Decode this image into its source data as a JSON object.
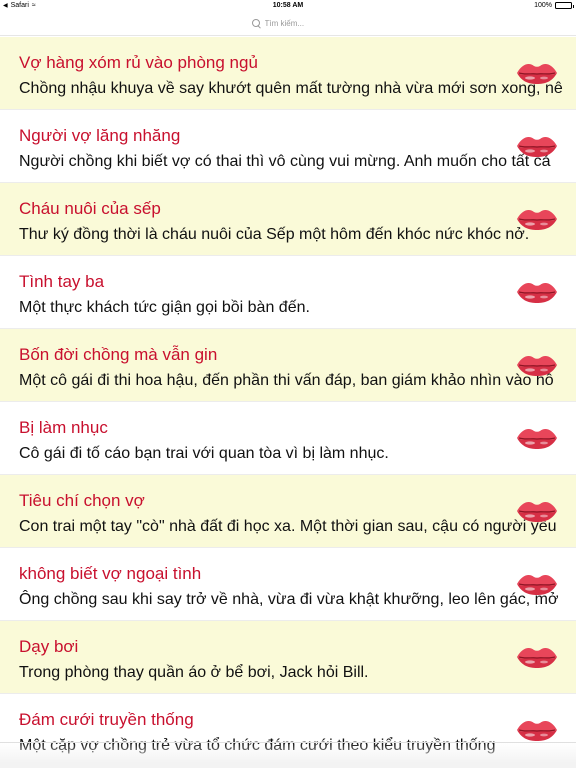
{
  "status_bar": {
    "app": "Safari",
    "time": "10:58 AM",
    "battery": "100%",
    "icons": [
      "back-icon",
      "wifi-icon",
      "battery-icon"
    ]
  },
  "search": {
    "placeholder": "Tìm kiếm..."
  },
  "icon_name": "lips-icon",
  "colors": {
    "title": "#c8102e",
    "alt_row": "#fafad8",
    "lips": "#e8465a"
  },
  "items": [
    {
      "title": "Vợ hàng xóm rủ vào phòng ngủ",
      "snippet": "Chồng nhậu khuya về say khướt quên mất tường nhà vừa mới sơn xong, nê"
    },
    {
      "title": "Người vợ lăng nhăng",
      "snippet": "Người chồng khi biết vợ có thai thì vô cùng vui mừng. Anh muốn cho tất cả"
    },
    {
      "title": "Cháu nuôi của sếp",
      "snippet": "Thư ký đồng thời là cháu nuôi của Sếp một hôm đến khóc nức khóc nở."
    },
    {
      "title": "Tình tay ba",
      "snippet": "Một thực khách tức giận gọi bồi bàn đến."
    },
    {
      "title": "Bốn đời chồng mà vẫn gin",
      "snippet": "Một cô gái đi thi hoa hậu, đến phần thi vấn đáp, ban giám khảo nhìn vào hồ"
    },
    {
      "title": "Bị làm nhục",
      "snippet": "Cô gái đi tố cáo bạn trai với quan tòa vì bị làm nhục."
    },
    {
      "title": "Tiêu chí chọn vợ",
      "snippet": "Con trai một tay \"cò\" nhà đất đi học xa. Một thời gian sau, cậu có người yêu"
    },
    {
      "title": "không biết vợ ngoại tình",
      "snippet": "Ông chồng sau khi say trở về nhà, vừa đi vừa khật khưỡng, leo lên gác, mở"
    },
    {
      "title": "Dạy bơi",
      "snippet": "Trong phòng thay quần áo ở bể bơi, Jack hỏi Bill."
    },
    {
      "title": "Đám cưới truyền thống",
      "snippet": "Một cặp vợ chồng trẻ vừa tổ chức đám cưới theo kiểu truyền thống"
    }
  ]
}
